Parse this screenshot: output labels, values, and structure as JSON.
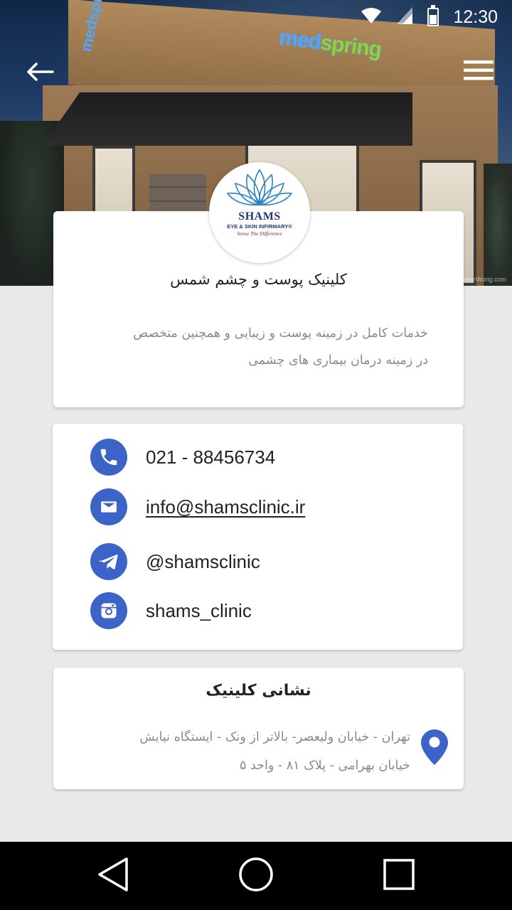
{
  "status_bar": {
    "time": "12:30",
    "icons": [
      "wifi-icon",
      "cell-signal-icon",
      "battery-icon"
    ]
  },
  "hero": {
    "sign_text_1": "med",
    "sign_text_2": "spring",
    "side_sign": "medspring",
    "watermark": "AtelierWong.com"
  },
  "toolbar": {
    "back_icon": "arrow-left-icon",
    "menu_icon": "hamburger-menu-icon"
  },
  "logo": {
    "name": "SHAMS",
    "subtitle": "EYE & SKIN INFIRMARY®",
    "tagline": "Sense The Difference"
  },
  "intro": {
    "title": "کلینیک پوست و چشم شمس",
    "description_line1": "خدمات کامل در زمینه پوست و زیبایی و همچنین متخصص",
    "description_line2": "در زمینه درمان  بیماری های چشمی"
  },
  "contact": {
    "phone": "021 - 88456734",
    "email": "info@shamsclinic.ir",
    "telegram": "@shamsclinic",
    "instagram": "shams_clinic"
  },
  "address": {
    "title": "نشانی کلینیک",
    "line1": "تهران - خیابان ولیعصر- بالاتر از ونک - ایستگاه نیایش",
    "line2": "خیابان بهرامی - پلاک ۸۱ - واحد ۵"
  },
  "colors": {
    "accent": "#3c64c8",
    "background": "#e9e9e9",
    "card": "#ffffff",
    "muted_text": "#8a8a8a"
  }
}
